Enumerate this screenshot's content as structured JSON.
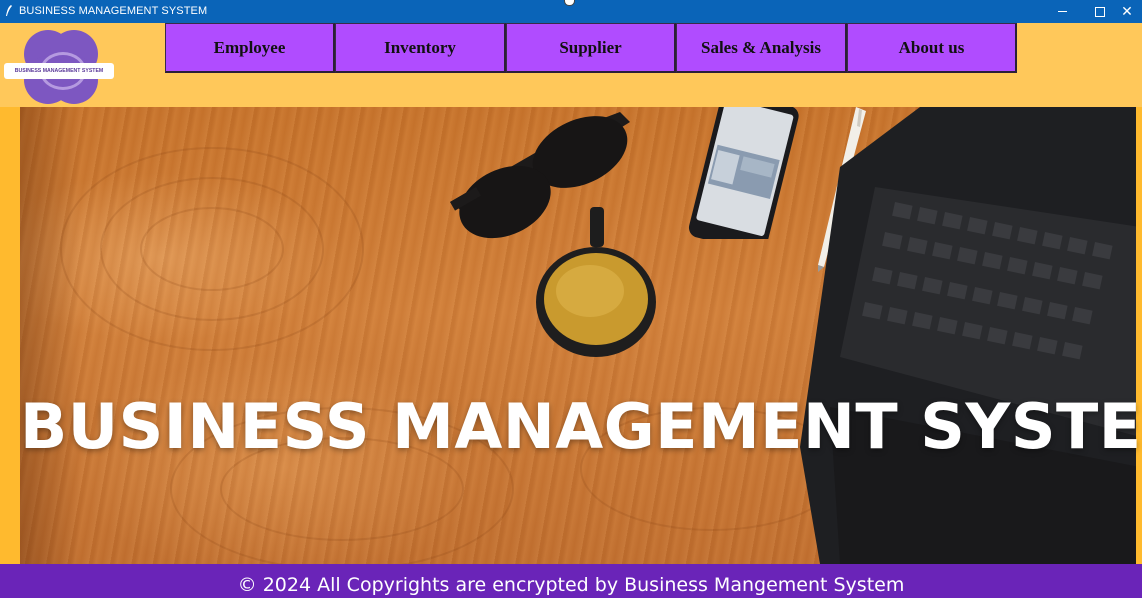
{
  "window": {
    "title": "BUSINESS MANAGEMENT SYSTEM",
    "close_glyph": "✕"
  },
  "logo": {
    "text": "BUSINESS MANAGEMENT SYSTEM"
  },
  "nav": {
    "items": [
      {
        "label": "Employee",
        "icon": null
      },
      {
        "label": "Inventory"
      },
      {
        "label": "Supplier"
      },
      {
        "label": "Sales & Analysis"
      },
      {
        "label": "About us"
      }
    ]
  },
  "hero": {
    "title": "BUSINESS MANAGEMENT SYSTEM"
  },
  "footer": {
    "text": "© 2024 All Copyrights are encrypted by Business Mangement System"
  },
  "colors": {
    "titlebar": "#0a64b8",
    "header": "#ffc85a",
    "nav_button": "#b04cff",
    "footer": "#6a24b8",
    "logo_purple": "#7d57c1"
  }
}
